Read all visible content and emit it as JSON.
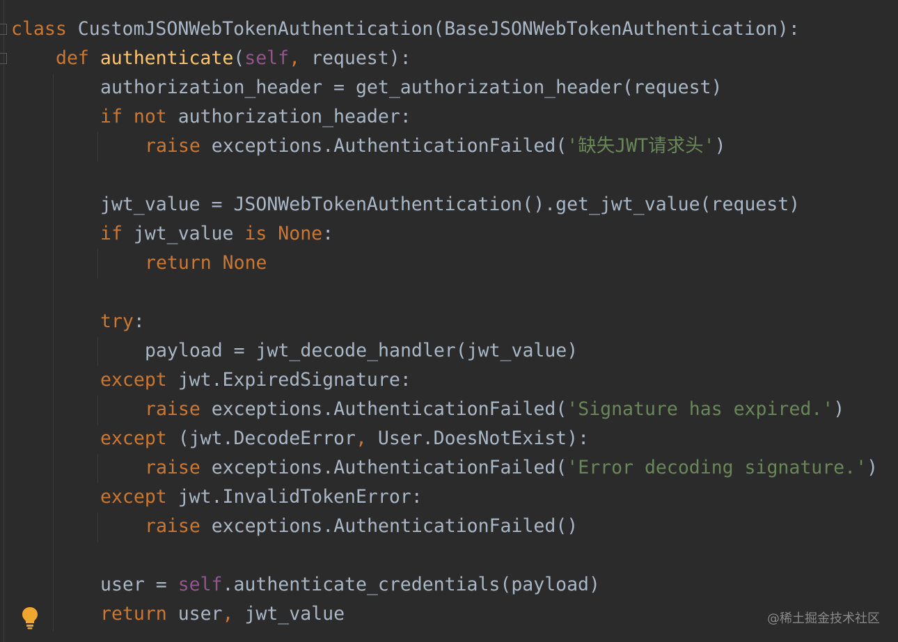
{
  "watermark": "@稀土掘金技术社区",
  "icons": {
    "intention": "lightbulb-icon",
    "fold": "fold-marker-icon"
  },
  "colors": {
    "background": "#2b2b2b",
    "keyword": "#cc7832",
    "function": "#ffc66d",
    "self": "#94558d",
    "string": "#6a8759",
    "text": "#a9b7c6"
  },
  "code": [
    {
      "indent": 0,
      "tokens": [
        [
          "kw",
          "class"
        ],
        [
          "txt",
          " CustomJSONWebTokenAuthentication(BaseJSONWebTokenAuthentication):"
        ]
      ]
    },
    {
      "indent": 1,
      "tokens": [
        [
          "kw",
          "def"
        ],
        [
          "txt",
          " "
        ],
        [
          "fn",
          "authenticate"
        ],
        [
          "txt",
          "("
        ],
        [
          "slf",
          "self"
        ],
        [
          "kw",
          ","
        ],
        [
          "txt",
          " request):"
        ]
      ]
    },
    {
      "indent": 2,
      "tokens": [
        [
          "txt",
          "authorization_header = get_authorization_header(request)"
        ]
      ]
    },
    {
      "indent": 2,
      "tokens": [
        [
          "kw",
          "if not"
        ],
        [
          "txt",
          " authorization_header:"
        ]
      ]
    },
    {
      "indent": 3,
      "tokens": [
        [
          "kw",
          "raise"
        ],
        [
          "txt",
          " exceptions.AuthenticationFailed("
        ],
        [
          "str",
          "'缺失JWT请求头'"
        ],
        [
          "txt",
          ")"
        ]
      ]
    },
    {
      "indent": 0,
      "tokens": []
    },
    {
      "indent": 2,
      "tokens": [
        [
          "txt",
          "jwt_value = JSONWebTokenAuthentication().get_jwt_value(request)"
        ]
      ]
    },
    {
      "indent": 2,
      "tokens": [
        [
          "kw",
          "if"
        ],
        [
          "txt",
          " jwt_value "
        ],
        [
          "kw",
          "is None"
        ],
        [
          "txt",
          ":"
        ]
      ]
    },
    {
      "indent": 3,
      "tokens": [
        [
          "kw",
          "return None"
        ]
      ]
    },
    {
      "indent": 0,
      "tokens": []
    },
    {
      "indent": 2,
      "tokens": [
        [
          "kw",
          "try"
        ],
        [
          "txt",
          ":"
        ]
      ]
    },
    {
      "indent": 3,
      "tokens": [
        [
          "txt",
          "payload = jwt_decode_handler(jwt_value)"
        ]
      ]
    },
    {
      "indent": 2,
      "tokens": [
        [
          "kw",
          "except"
        ],
        [
          "txt",
          " jwt.ExpiredSignature:"
        ]
      ]
    },
    {
      "indent": 3,
      "tokens": [
        [
          "kw",
          "raise"
        ],
        [
          "txt",
          " exceptions.AuthenticationFailed("
        ],
        [
          "str",
          "'Signature has expired.'"
        ],
        [
          "txt",
          ")"
        ]
      ]
    },
    {
      "indent": 2,
      "tokens": [
        [
          "kw",
          "except"
        ],
        [
          "txt",
          " (jwt.DecodeError"
        ],
        [
          "kw",
          ","
        ],
        [
          "txt",
          " User.DoesNotExist):"
        ]
      ]
    },
    {
      "indent": 3,
      "tokens": [
        [
          "kw",
          "raise"
        ],
        [
          "txt",
          " exceptions.AuthenticationFailed("
        ],
        [
          "str",
          "'Error decoding signature.'"
        ],
        [
          "txt",
          ")"
        ]
      ]
    },
    {
      "indent": 2,
      "tokens": [
        [
          "kw",
          "except"
        ],
        [
          "txt",
          " jwt.InvalidTokenError:"
        ]
      ]
    },
    {
      "indent": 3,
      "tokens": [
        [
          "kw",
          "raise"
        ],
        [
          "txt",
          " exceptions.AuthenticationFailed()"
        ]
      ]
    },
    {
      "indent": 0,
      "tokens": []
    },
    {
      "indent": 2,
      "tokens": [
        [
          "txt",
          "user = "
        ],
        [
          "slf",
          "self"
        ],
        [
          "txt",
          ".authenticate_credentials(payload)"
        ]
      ]
    },
    {
      "indent": 2,
      "tokens": [
        [
          "kw",
          "return"
        ],
        [
          "txt",
          " user"
        ],
        [
          "kw",
          ","
        ],
        [
          "txt",
          " jwt_value"
        ]
      ]
    }
  ]
}
